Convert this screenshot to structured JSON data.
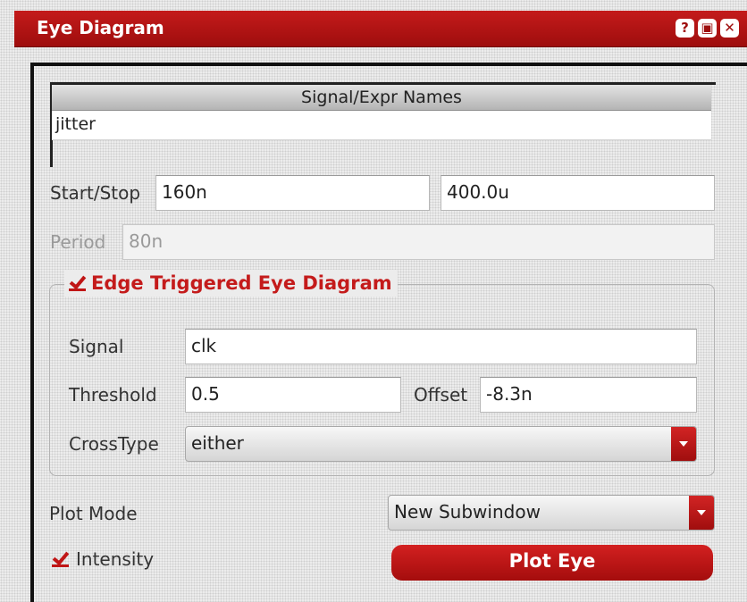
{
  "window": {
    "title": "Eye Diagram",
    "buttons": {
      "help": "?",
      "restore": "▣",
      "close": "✕"
    }
  },
  "signal_list": {
    "header": "Signal/Expr Names",
    "items": [
      "jitter"
    ]
  },
  "start_stop": {
    "label": "Start/Stop",
    "start": "160n",
    "stop": "400.0u"
  },
  "period": {
    "label": "Period",
    "value": "80n",
    "enabled": false
  },
  "edge_triggered": {
    "label": "Edge Triggered Eye Diagram",
    "checked": true,
    "signal": {
      "label": "Signal",
      "value": "clk"
    },
    "threshold": {
      "label": "Threshold",
      "value": "0.5"
    },
    "offset": {
      "label": "Offset",
      "value": "-8.3n"
    },
    "crosstype": {
      "label": "CrossType",
      "value": "either"
    }
  },
  "plot_mode": {
    "label": "Plot Mode",
    "value": "New Subwindow"
  },
  "intensity": {
    "label": "Intensity",
    "checked": true
  },
  "plot_button": {
    "label": "Plot Eye"
  },
  "colors": {
    "accent": "#c41b1b",
    "accent_dark": "#9e0d0d"
  }
}
